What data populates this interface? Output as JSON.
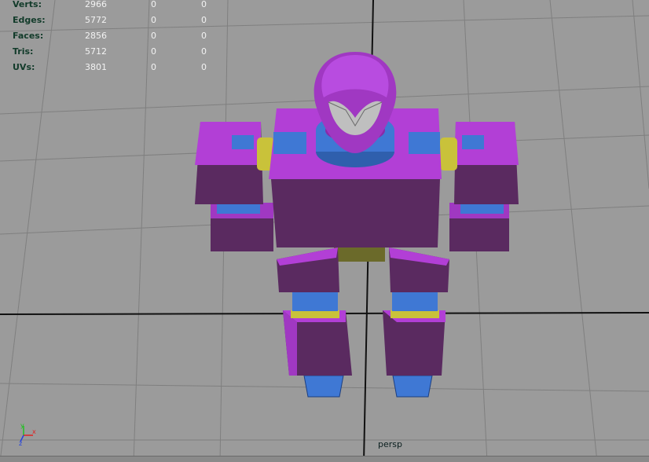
{
  "viewport": {
    "camera_label": "persp"
  },
  "hud": {
    "rows": [
      {
        "label": "Verts:",
        "v1": "2966",
        "v2": "0",
        "v3": "0"
      },
      {
        "label": "Edges:",
        "v1": "5772",
        "v2": "0",
        "v3": "0"
      },
      {
        "label": "Faces:",
        "v1": "2856",
        "v2": "0",
        "v3": "0"
      },
      {
        "label": "Tris:",
        "v1": "5712",
        "v2": "0",
        "v3": "0"
      },
      {
        "label": "UVs:",
        "v1": "3801",
        "v2": "0",
        "v3": "0"
      }
    ]
  },
  "axis_gizmo": {
    "x_label": "x",
    "y_label": "y",
    "z_label": "z",
    "x_color": "#e02020",
    "y_color": "#20c020",
    "z_color": "#2040e0"
  },
  "colors": {
    "background": "#9b9b9b",
    "grid": "#7f7f7f",
    "grid_axis": "#111111",
    "purple_light": "#b23fd6",
    "purple_dark": "#5a2a60",
    "blue": "#3f78d4",
    "yellow": "#c9c23a",
    "olive": "#6b6a2a"
  }
}
